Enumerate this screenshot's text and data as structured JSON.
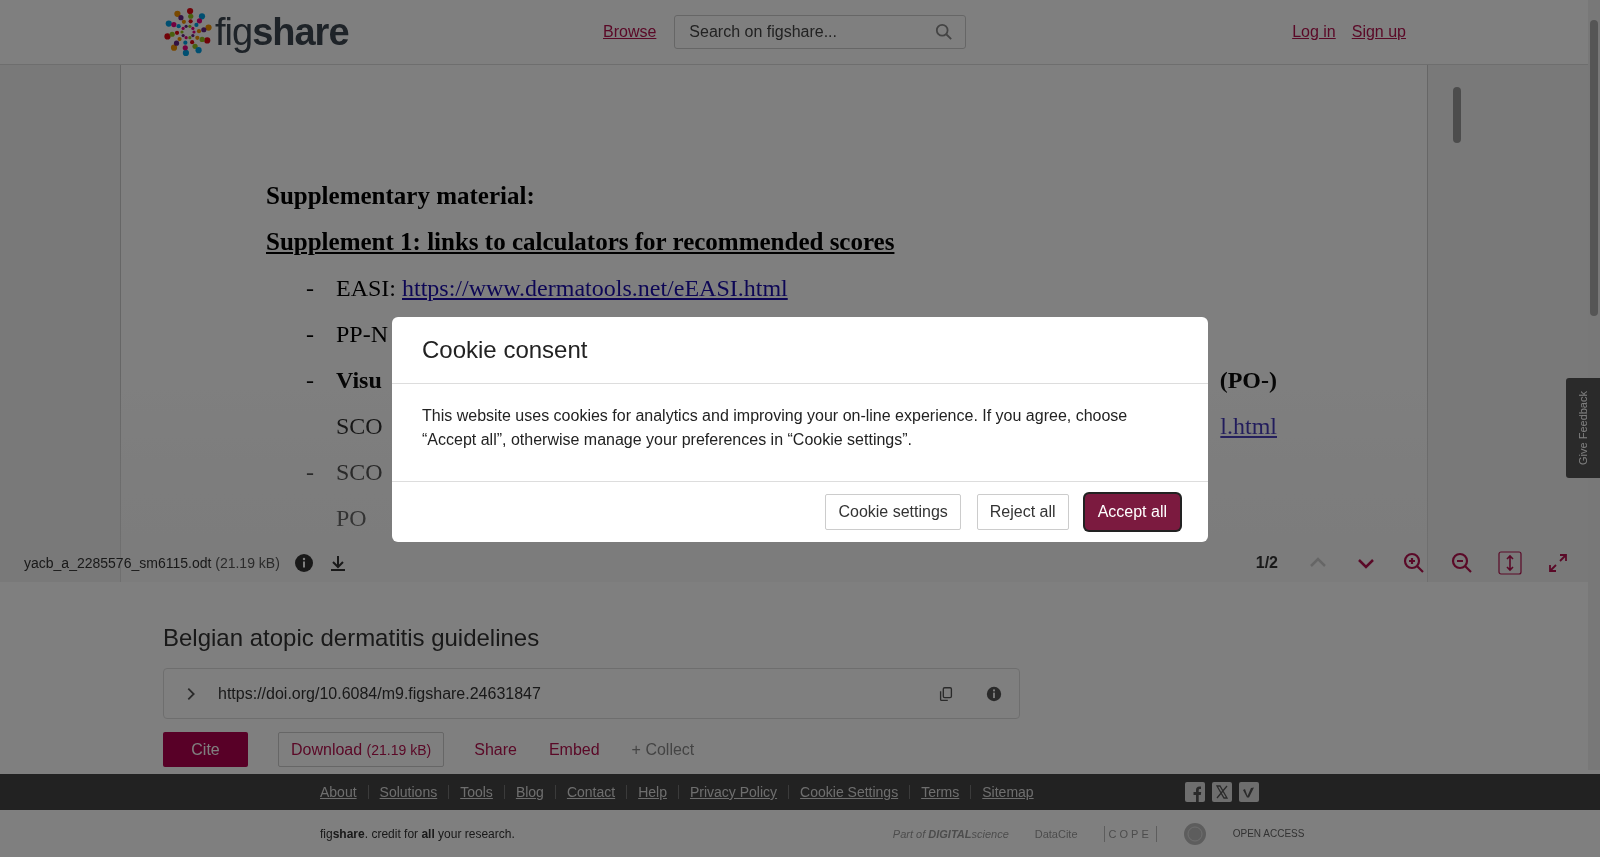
{
  "header": {
    "logo": "fig**share**",
    "nav_link": "Browse",
    "search": {
      "placeholder": "Search on figshare..."
    },
    "auth_links": [
      "Log in",
      "Sign up"
    ]
  },
  "document": {
    "lines": [
      {
        "kind": "heading",
        "text": "Supplementary material:"
      },
      {
        "kind": "heading_underlined",
        "text": "Supplement 1: links to calculators for recommended scores"
      },
      {
        "kind": "bullet",
        "marker": "-",
        "text": "EASI: ",
        "link": "https://www.dermatools.net/eEASI.html"
      },
      {
        "kind": "bullet",
        "marker": "-",
        "text": "PP-N"
      },
      {
        "kind": "bullet_bold",
        "marker": "-",
        "text": "Visu",
        "right": "(PO-)"
      },
      {
        "kind": "continuation",
        "text": "SCO",
        "right_link": "l.html"
      },
      {
        "kind": "bullet",
        "marker": "-",
        "text": "SCO"
      },
      {
        "kind": "continuation",
        "text": "PO"
      }
    ]
  },
  "viewer_toolbar": {
    "file_name": "yacb_a_2285576_sm6115.odt",
    "file_size": "(21.19 kB)",
    "page": "1/2",
    "tools": [
      {
        "kind": "prev",
        "disabled": true,
        "selected": false
      },
      {
        "kind": "next",
        "disabled": false,
        "selected": false
      },
      {
        "kind": "zoom_in",
        "disabled": false,
        "selected": false
      },
      {
        "kind": "zoom_out",
        "disabled": false,
        "selected": false
      },
      {
        "kind": "fit_height",
        "disabled": false,
        "selected": true
      },
      {
        "kind": "fullscreen",
        "disabled": false,
        "selected": false
      }
    ]
  },
  "feedback_tab": "Give Feedback",
  "item": {
    "title": "Belgian atopic dermatitis guidelines",
    "doi": "https://doi.org/10.6084/m9.figshare.24631847",
    "actions": [
      {
        "kind": "primary",
        "label": "Cite"
      },
      {
        "kind": "outline",
        "label": "Download",
        "size": "(21.19 kB)"
      },
      {
        "kind": "link",
        "label": "Share"
      },
      {
        "kind": "link",
        "label": "Embed"
      },
      {
        "kind": "muted",
        "label": "+ Collect"
      }
    ]
  },
  "footer": {
    "links": [
      "About",
      "Solutions",
      "Tools",
      "Blog",
      "Contact",
      "Help",
      "Privacy Policy",
      "Cookie Settings",
      "Terms",
      "Sitemap"
    ],
    "tagline": "fig**share**. credit for **all** your research.",
    "partners": [
      {
        "kind": "digital_science",
        "text": "Part of **DIGITAL**science"
      },
      {
        "kind": "datacite",
        "text": "DataCite"
      },
      {
        "kind": "cope",
        "text": "COPE"
      },
      {
        "kind": "seal"
      },
      {
        "kind": "open_access",
        "text": "OPEN ACCESS"
      }
    ]
  },
  "cookie_modal": {
    "title": "Cookie consent",
    "body": "This website uses cookies for analytics and improving your on-line experience. If you agree, choose “Accept all”, otherwise manage your preferences in “Cookie settings”.",
    "buttons": [
      {
        "kind": "secondary",
        "label": "Cookie settings",
        "focused": false
      },
      {
        "kind": "secondary",
        "label": "Reject all",
        "focused": false
      },
      {
        "kind": "primary",
        "label": "Accept all",
        "focused": true
      }
    ]
  }
}
